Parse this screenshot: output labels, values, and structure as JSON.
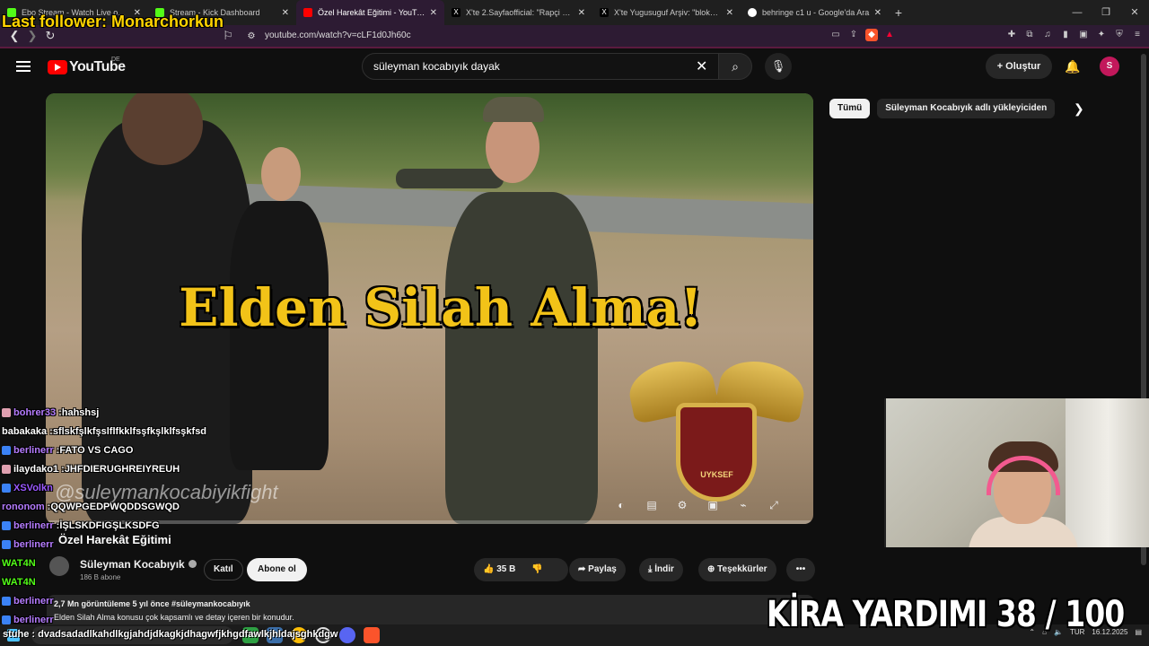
{
  "browser": {
    "tabs": [
      {
        "label": "Ebo Stream - Watch Live on Kick",
        "fav_color": "#53fc18",
        "active": false
      },
      {
        "label": "Stream - Kick Dashboard",
        "fav_color": "#53fc18",
        "active": false
      },
      {
        "label": "Özel Harekât Eğitimi - YouTube",
        "fav_color": "#ff0000",
        "active": true
      },
      {
        "label": "X'te 2.Sayfaofficial: \"Rapçi Blok3, İstan",
        "fav_color": "#000000",
        "active": false
      },
      {
        "label": "X'te Yugusuguf Arşiv: \"blok3 amca su",
        "fav_color": "#000000",
        "active": false
      },
      {
        "label": "behringe c1 u - Google'da Ara",
        "fav_color": "#4285f4",
        "active": false
      }
    ],
    "url": "youtube.com/watch?v=cLF1d0Jh60c"
  },
  "overlay": {
    "last_follower": "Last follower: Monarchorkun",
    "donation_banner": "KİRA YARDIMI  38 / 100"
  },
  "youtube": {
    "logo_text": "YouTube",
    "country": "DE",
    "search_value": "süleyman kocabıyık dayak",
    "create_label": "Oluştur",
    "avatar_letter": "S",
    "chips": [
      "Tümü",
      "Süleyman Kocabıyık adlı yükleyiciden"
    ],
    "video": {
      "overlay_title": "Elden Silah Alma!",
      "watermark": "@suleymankocabiyikfight",
      "emblem_text": "UYKSEF",
      "title": "Özel Harekât Eğitimi",
      "channel": "Süleyman Kocabıyık",
      "subs": "186 B abone",
      "join_label": "Katıl",
      "subscribe_label": "Abone ol",
      "likes": "35 B",
      "share_label": "Paylaş",
      "download_label": "İndir",
      "thanks_label": "Teşekkürler",
      "meta": "2,7 Mn görüntüleme  5 yıl önce  #süleymankocabıyık",
      "description": "Elden Silah Alma konusu çok kapsamlı ve detay içeren bir konudur."
    }
  },
  "chat": [
    {
      "user": "bohrer33",
      "msg": "hahshsj",
      "color": "#b57cff",
      "badge": "#e0a0b0"
    },
    {
      "user": "babakaka",
      "msg": "sflskfşlkfşslflfkklfsşfkşlklfsşkfsd",
      "color": "#ffffff",
      "badge": ""
    },
    {
      "user": "berlinerr",
      "msg": "FATO VS CAGO",
      "color": "#b57cff",
      "badge": "#3b82f6"
    },
    {
      "user": "ilaydako1",
      "msg": "JHFDIERUGHREIYREUH",
      "color": "#ffffff",
      "badge": "#e0a0b0"
    },
    {
      "user": "XSVolkn",
      "msg": "",
      "color": "#9b59ff",
      "badge": "#3b82f6"
    },
    {
      "user": "rononom",
      "msg": "QQWPGEDPWQDDSGWQD",
      "color": "#b57cff",
      "badge": ""
    },
    {
      "user": "berlinerr",
      "msg": "İŞLSKDFIGŞLKSDFG",
      "color": "#b57cff",
      "badge": "#3b82f6"
    },
    {
      "user": "berlinerr",
      "msg": "",
      "color": "#b57cff",
      "badge": "#3b82f6"
    },
    {
      "user": "WAT4N",
      "msg": "",
      "color": "#53fc18",
      "badge": ""
    },
    {
      "user": "WAT4N",
      "msg": "",
      "color": "#53fc18",
      "badge": ""
    },
    {
      "user": "berlinerr",
      "msg": "",
      "color": "#b57cff",
      "badge": "#3b82f6"
    },
    {
      "user": "berlinerr",
      "msg": "",
      "color": "#b57cff",
      "badge": "#3b82f6"
    }
  ],
  "chat_bottom": "stuhe : dvadsadadlkahdlkgjahdjdkagkjdhagwfjkhgdfawlkjhldajsghkdgw",
  "taskbar": {
    "language": "TUR",
    "date": "16.12.2025"
  }
}
